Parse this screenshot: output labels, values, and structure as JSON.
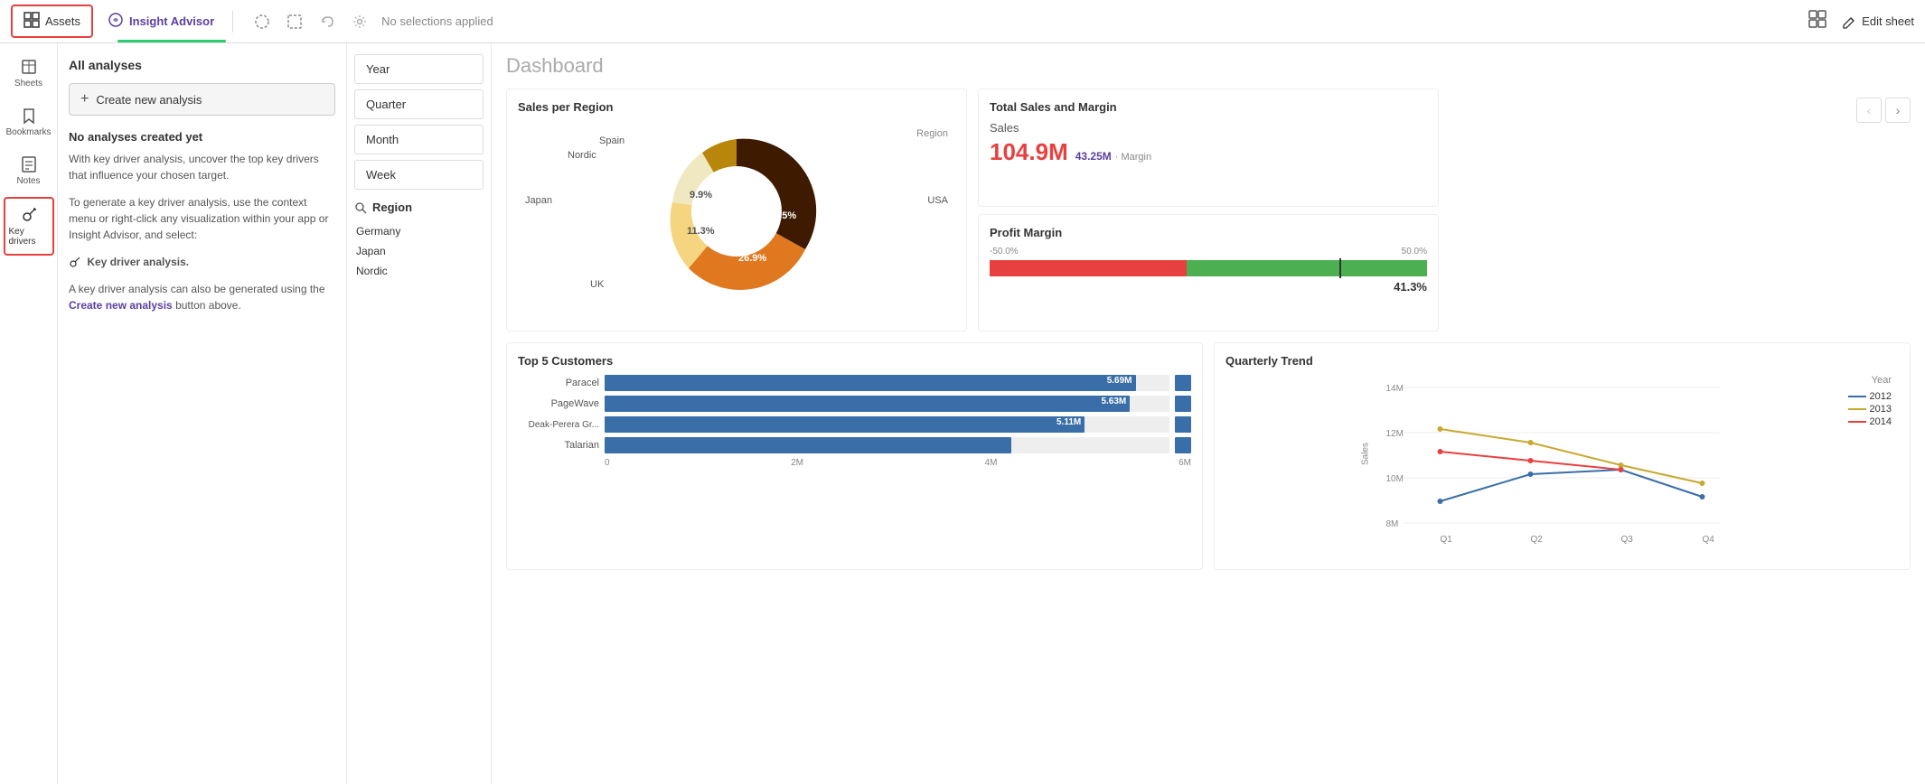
{
  "topNav": {
    "assets_label": "Assets",
    "insight_advisor_label": "Insight Advisor",
    "no_selections_label": "No selections applied",
    "edit_sheet_label": "Edit sheet"
  },
  "sidebar": {
    "items": [
      {
        "id": "sheets",
        "label": "Sheets",
        "icon": "sheets"
      },
      {
        "id": "bookmarks",
        "label": "Bookmarks",
        "icon": "bookmarks"
      },
      {
        "id": "notes",
        "label": "Notes",
        "icon": "notes"
      },
      {
        "id": "key-drivers",
        "label": "Key drivers",
        "icon": "key-drivers"
      }
    ]
  },
  "analysisPanel": {
    "title": "All analyses",
    "create_btn_label": "Create new analysis",
    "no_analyses_title": "No analyses created yet",
    "description1": "With key driver analysis, uncover the top key drivers that influence your chosen target.",
    "description2": "To generate a key driver analysis, use the context menu or right-click any visualization within your app or Insight Advisor, and select:",
    "key_driver_label": "Key driver analysis.",
    "description3": "A key driver analysis can also be generated using the ",
    "create_new_label": "Create new analysis",
    "description4": " button above."
  },
  "filters": {
    "items": [
      "Year",
      "Quarter",
      "Month",
      "Week"
    ],
    "region_header": "Region",
    "region_items": [
      "Germany",
      "Japan",
      "Nordic"
    ]
  },
  "dashboard": {
    "title": "Dashboard",
    "charts": {
      "sales_per_region": {
        "title": "Sales per Region",
        "segments": [
          {
            "label": "USA",
            "pct": 45.5,
            "color": "#3d1a00"
          },
          {
            "label": "UK",
            "pct": 26.9,
            "color": "#e07820"
          },
          {
            "label": "Japan",
            "pct": 11.3,
            "color": "#f5d580"
          },
          {
            "label": "Nordic",
            "pct": 9.9,
            "color": "#f0e8c0"
          },
          {
            "label": "Spain",
            "pct": 3.5,
            "color": "#b8860b"
          },
          {
            "label": "Region",
            "note": "legend"
          }
        ]
      },
      "total_sales": {
        "title": "Total Sales and Margin",
        "sales_label": "Sales",
        "sales_value": "104.9M",
        "margin_value": "43.25M",
        "margin_suffix": "· Margin",
        "margin_pct": "41.3%"
      },
      "profit_margin": {
        "title": "Profit Margin",
        "scale_min": "-50.0%",
        "scale_max": "50.0%",
        "value": "41.3%"
      },
      "top5_customers": {
        "title": "Top 5 Customers",
        "bars": [
          {
            "label": "Paracel",
            "value": "5.69M",
            "pct": 94
          },
          {
            "label": "PageWave",
            "value": "5.63M",
            "pct": 93
          },
          {
            "label": "Deak-Perera Gr...",
            "value": "5.11M",
            "pct": 85
          },
          {
            "label": "Talarian",
            "value": "",
            "pct": 72
          }
        ],
        "axis": [
          "0",
          "2M",
          "4M",
          "6M"
        ]
      },
      "quarterly_trend": {
        "title": "Quarterly Trend",
        "y_label": "Sales",
        "y_axis": [
          "14M",
          "12M",
          "10M",
          "8M"
        ],
        "x_axis": [
          "Q1",
          "Q2",
          "Q3",
          "Q4"
        ],
        "legend": [
          {
            "year": "2012",
            "color": "#3a6ea8"
          },
          {
            "year": "2013",
            "color": "#c8a830"
          },
          {
            "year": "2014",
            "color": "#e84040"
          }
        ],
        "title_label": "Year"
      }
    }
  }
}
